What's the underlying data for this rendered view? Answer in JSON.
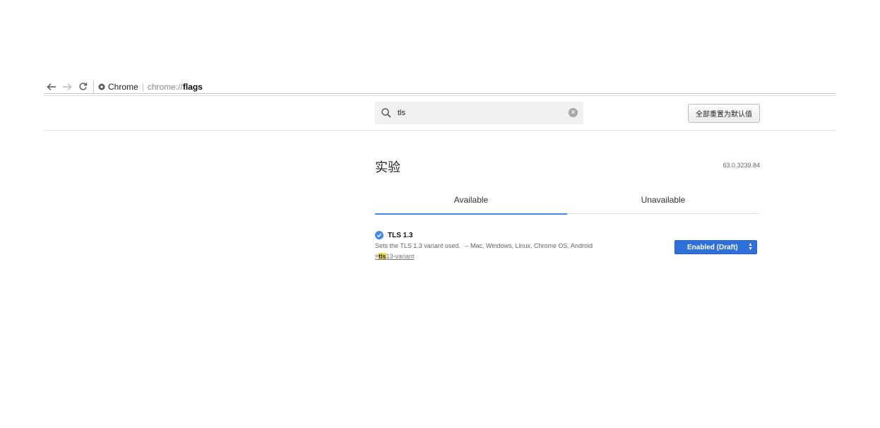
{
  "browser": {
    "site_label": "Chrome",
    "url_scheme": "chrome://",
    "url_path": "flags"
  },
  "header": {
    "search": {
      "value": "tls",
      "placeholder": ""
    },
    "reset_button_label": "全部重置为默认值"
  },
  "page": {
    "title": "实验",
    "version": "63.0.3239.84"
  },
  "tabs": [
    {
      "label": "Available"
    },
    {
      "label": "Unavailable"
    }
  ],
  "experiment": {
    "name": "TLS 1.3",
    "description": "Sets the TLS 1.3 variant used.",
    "platforms": "– Mac, Windows, Linux, Chrome OS, Android",
    "link_prefix": "#",
    "link_highlight": "tls",
    "link_suffix": "13-variant",
    "selected_state": "Enabled (Draft)"
  },
  "colors": {
    "accent": "#4285f4",
    "select_bg": "#2f6fd8",
    "highlight": "#f7e14a"
  }
}
